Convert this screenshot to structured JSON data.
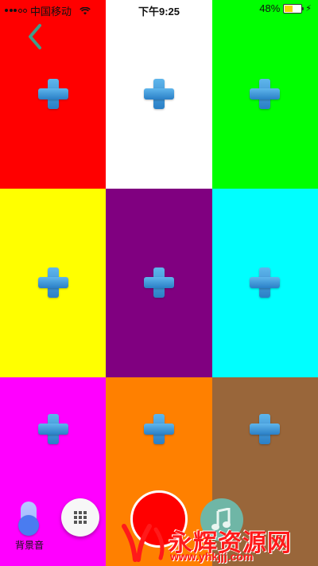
{
  "status_bar": {
    "carrier": "中国移动",
    "time": "下午9:25",
    "battery_percent": "48%",
    "battery_level": 0.48,
    "battery_color": "#f2d600",
    "charging_icon": "bolt-icon",
    "wifi_icon": "wifi-icon"
  },
  "nav": {
    "back_icon": "chevron-left-icon",
    "back_color": "#3f9e8a"
  },
  "tiles": [
    {
      "color": "#ff0000",
      "icon": "add-icon"
    },
    {
      "color": "#ffffff",
      "icon": "add-icon"
    },
    {
      "color": "#00ff00",
      "icon": "add-icon"
    },
    {
      "color": "#ffff00",
      "icon": "add-icon"
    },
    {
      "color": "#800080",
      "icon": "add-icon"
    },
    {
      "color": "#00ffff",
      "icon": "add-icon"
    },
    {
      "color": "#ff00ff",
      "icon": "add-icon"
    },
    {
      "color": "#ff8000",
      "icon": "add-icon"
    },
    {
      "color": "#99663a",
      "icon": "add-icon"
    }
  ],
  "controls": {
    "bgm_label": "背景音",
    "bgm_toggle_on": true,
    "grid_icon": "grid-icon",
    "record_color": "#ff0000",
    "music_icon": "music-note-icon"
  },
  "watermark": {
    "title": "永辉资源网",
    "url": "www.yhkjjj.com"
  }
}
